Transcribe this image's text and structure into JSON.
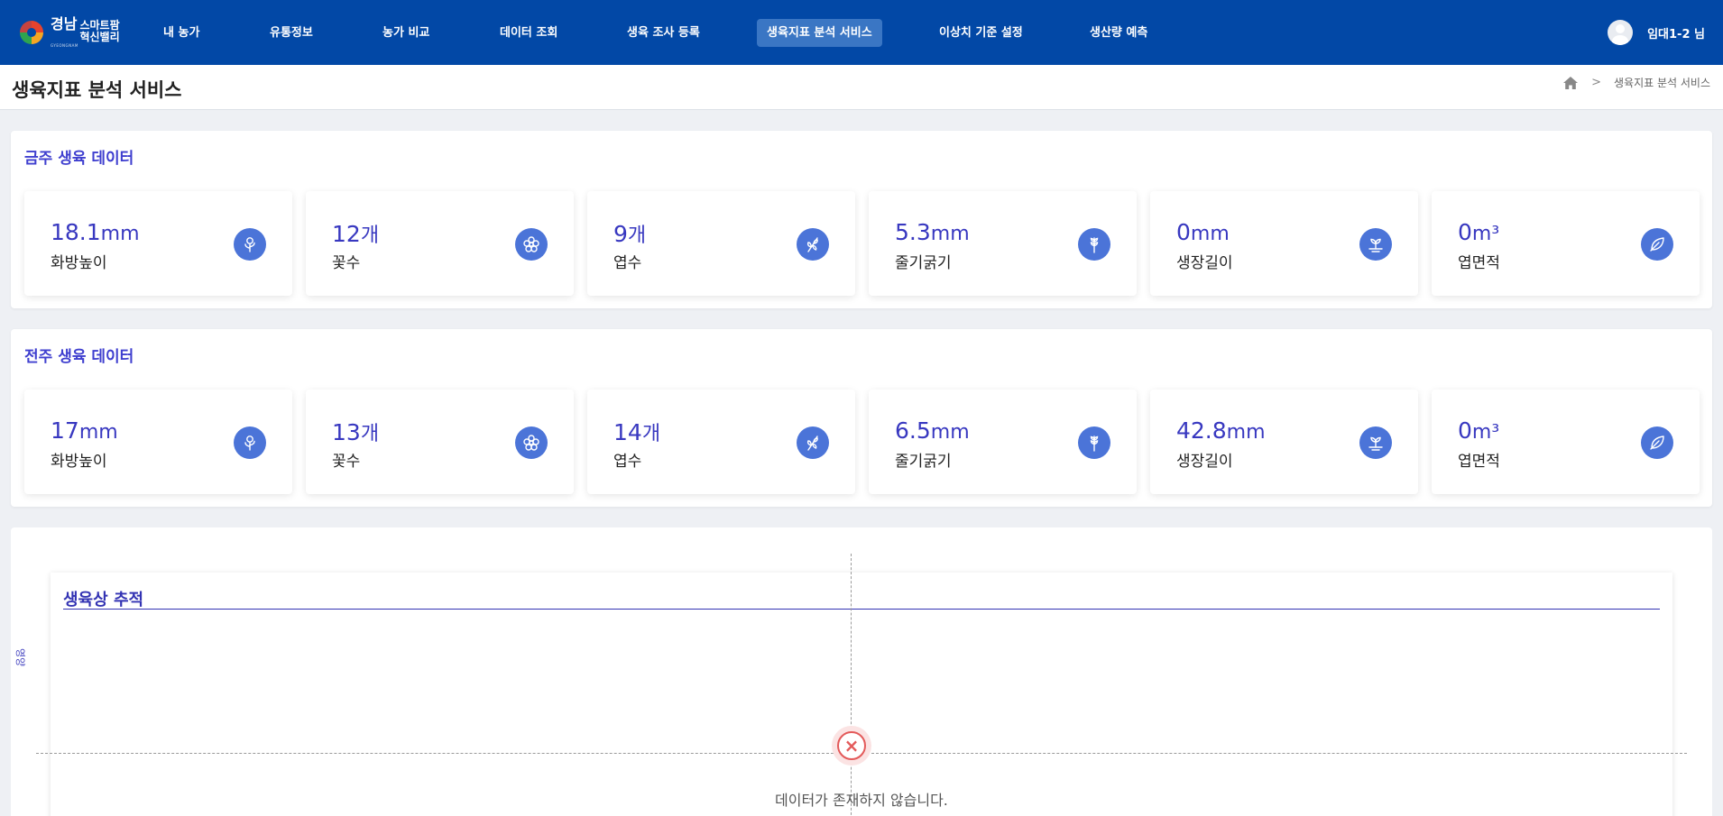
{
  "app": {
    "logo_main_left": "경남",
    "logo_main_right": "스마트팜\n혁신밸리",
    "logo_sub": "GYEONGNAM"
  },
  "nav": {
    "items": [
      {
        "label": "내 농가"
      },
      {
        "label": "유통정보"
      },
      {
        "label": "농가 비교"
      },
      {
        "label": "데이터 조회"
      },
      {
        "label": "생육 조사 등록"
      },
      {
        "label": "생육지표 분석 서비스"
      },
      {
        "label": "이상치 기준 설정"
      },
      {
        "label": "생산량 예측"
      }
    ],
    "active_index": 5,
    "user": "임대1-2 님"
  },
  "page": {
    "title": "생육지표 분석 서비스",
    "breadcrumb_current": "생육지표 분석 서비스"
  },
  "this_week": {
    "title": "금주 생육 데이터",
    "cards": [
      {
        "value": "18.1",
        "unit": "mm",
        "label": "화방높이",
        "icon": "flower-stem-icon"
      },
      {
        "value": "12",
        "unit": "개",
        "label": "꽃수",
        "icon": "flower-icon"
      },
      {
        "value": "9",
        "unit": "개",
        "label": "엽수",
        "icon": "leaf-branch-icon"
      },
      {
        "value": "5.3",
        "unit": "mm",
        "label": "줄기굵기",
        "icon": "wheat-stem-icon"
      },
      {
        "value": "0",
        "unit": "mm",
        "label": "생장길이",
        "icon": "sprout-icon"
      },
      {
        "value": "0",
        "unit": "m³",
        "label": "엽면적",
        "icon": "leaf-icon"
      }
    ]
  },
  "last_week": {
    "title": "전주 생육 데이터",
    "cards": [
      {
        "value": "17",
        "unit": "mm",
        "label": "화방높이",
        "icon": "flower-stem-icon"
      },
      {
        "value": "13",
        "unit": "개",
        "label": "꽃수",
        "icon": "flower-icon"
      },
      {
        "value": "14",
        "unit": "개",
        "label": "엽수",
        "icon": "leaf-branch-icon"
      },
      {
        "value": "6.5",
        "unit": "mm",
        "label": "줄기굵기",
        "icon": "wheat-stem-icon"
      },
      {
        "value": "42.8",
        "unit": "mm",
        "label": "생장길이",
        "icon": "sprout-icon"
      },
      {
        "value": "0",
        "unit": "m³",
        "label": "엽면적",
        "icon": "leaf-icon"
      }
    ]
  },
  "chart": {
    "title": "생육상 추적",
    "ylabel": "영양",
    "empty_message": "데이터가 존재하지 않습니다."
  },
  "colors": {
    "nav_bg": "#0248a6",
    "accent": "#3838c0",
    "icon_bg": "#4b74d8",
    "error": "#e35a5a"
  }
}
